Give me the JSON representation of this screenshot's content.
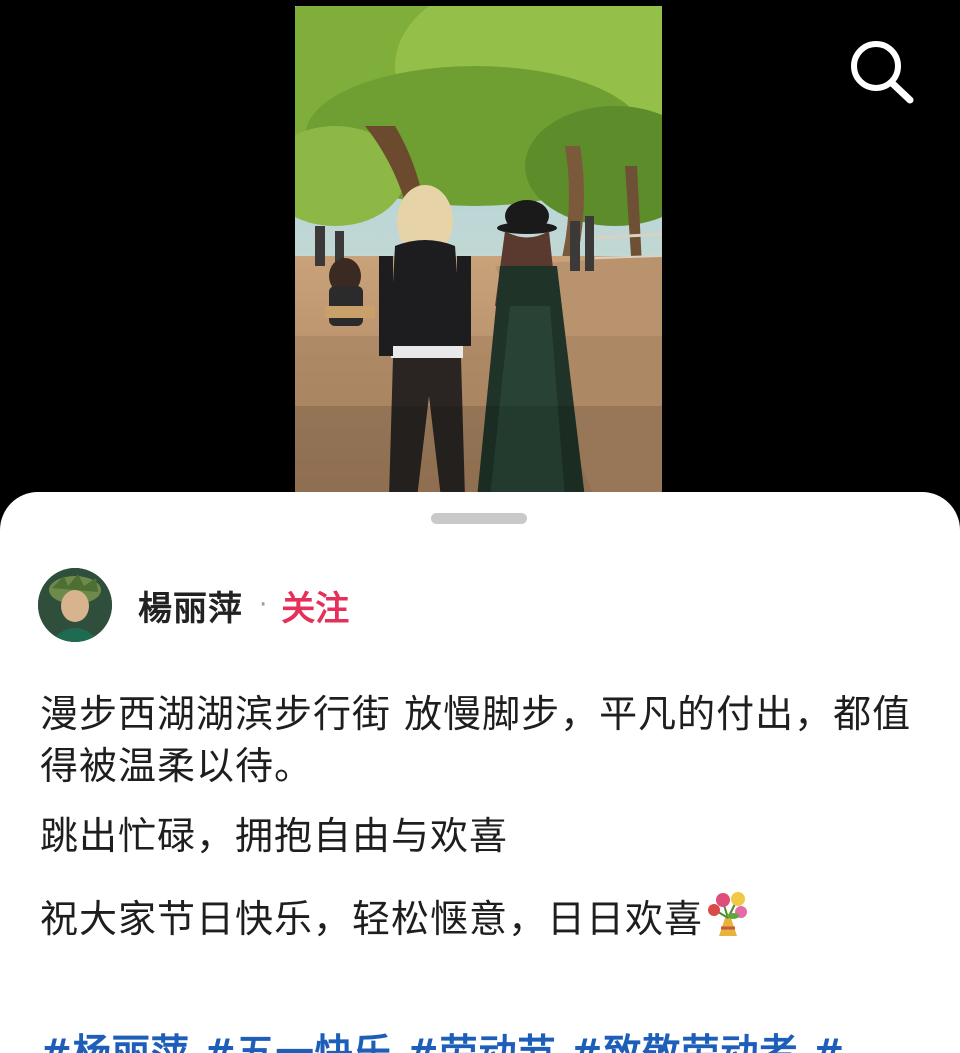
{
  "video": {
    "scene_icon": "video-still"
  },
  "toolbar": {
    "search_icon": "search-icon"
  },
  "author": {
    "name": "楊丽萍",
    "separator": "·",
    "follow_label": "关注"
  },
  "post": {
    "line1": "漫步西湖湖滨步行街 放慢脚步，平凡的付出，都值得被温柔以待。",
    "line2": "跳出忙碌，拥抱自由与欢喜",
    "line3": "祝大家节日快乐，轻松惬意，日日欢喜",
    "line3_emoji_icon": "bouquet-icon",
    "hashtags": [
      "#杨丽萍",
      "#五一快乐",
      "#劳动节",
      "#致敬劳动者",
      "#"
    ]
  },
  "colors": {
    "follow": "#e5315a",
    "hashtag": "#1d5fb8",
    "background": "#000000",
    "sheet": "#ffffff"
  }
}
